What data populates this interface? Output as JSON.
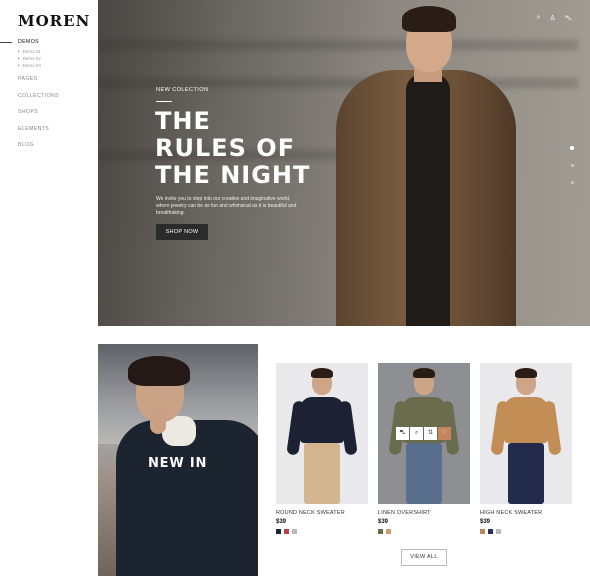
{
  "brand": {
    "logo": "MOREN"
  },
  "sidebar": {
    "items": [
      {
        "label": "DEMOS",
        "sub": [
          "Demo 01",
          "Demo 02",
          "Demo 03"
        ]
      },
      {
        "label": "PAGES"
      },
      {
        "label": "COLLECTIONS"
      },
      {
        "label": "SHOPS"
      },
      {
        "label": "ELEMENTS"
      },
      {
        "label": "BLOG"
      }
    ]
  },
  "header": {
    "icons": [
      "search-icon",
      "user-icon",
      "cart-icon"
    ]
  },
  "hero": {
    "eyebrow": "NEW COLECTION",
    "title_lines": [
      "THE",
      "RULES OF",
      "THE NIGHT"
    ],
    "description": "We invite you to step into our creative and imaginative world, where jewelry can be as fun and whimsical as it is beautiful and breathtaking.",
    "button": "SHOP NOW",
    "active_slide_index": 0,
    "slide_count": 3
  },
  "banner": {
    "label": "NEW IN"
  },
  "products": [
    {
      "name": "ROUND NECK SWEATER",
      "price": "$39",
      "swatches": [
        "#1f2433",
        "#b4423f",
        "#b9b9b9"
      ],
      "colors": {
        "top": "#1c2233",
        "legs": "#d3b690"
      }
    },
    {
      "name": "LINEN OVERSHIRT",
      "price": "$39",
      "swatches": [
        "#6f6a4a",
        "#c9a06b"
      ],
      "colors": {
        "top": "#6b6b4e",
        "legs": "#5a6e8d"
      },
      "hover_actions": [
        "cart-icon",
        "search-icon",
        "compare-icon",
        "heart-icon"
      ]
    },
    {
      "name": "HIGH NECK SWEATER",
      "price": "$39",
      "swatches": [
        "#b8865f",
        "#2b2f5a",
        "#b9b9b9"
      ],
      "colors": {
        "top": "#c38d56",
        "legs": "#232b4d"
      }
    }
  ],
  "view_all": "VIEW ALL",
  "colors": {
    "accent": "#c4855e",
    "button_dark": "#2b2b2b"
  }
}
